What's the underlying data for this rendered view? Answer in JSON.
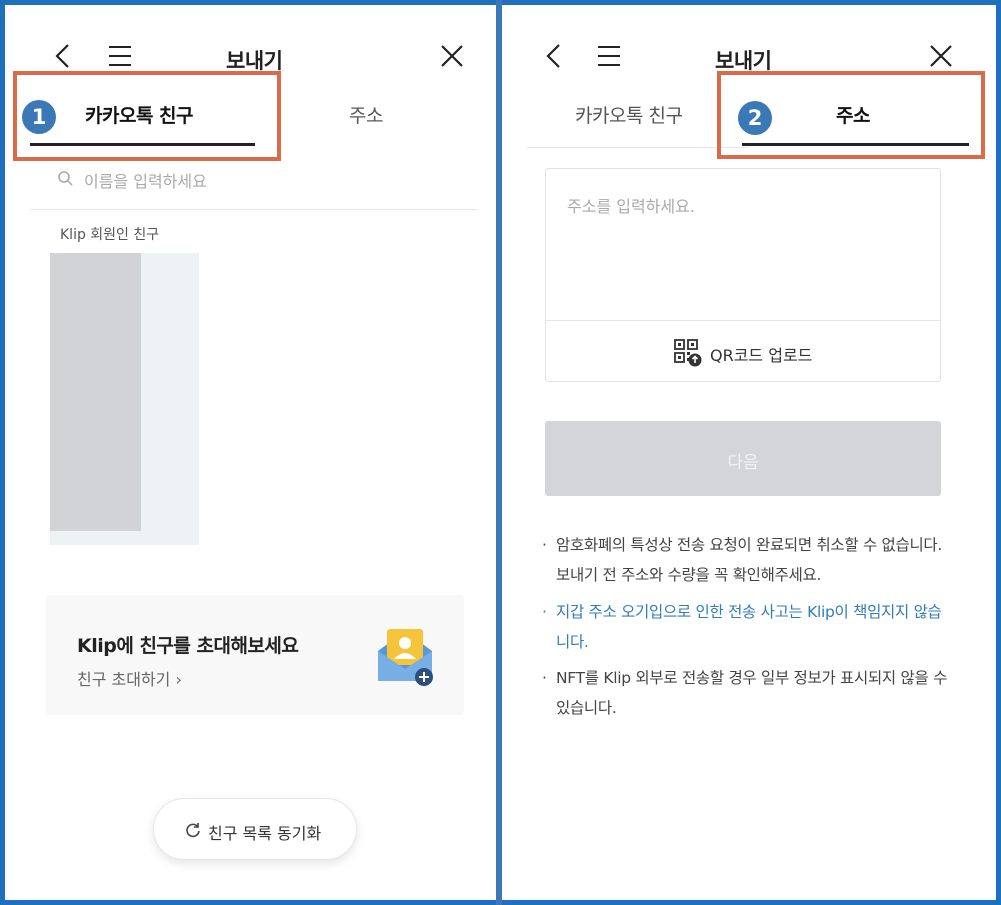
{
  "left": {
    "title": "보내기",
    "tabs": [
      {
        "label": "카카오톡 친구",
        "active": true
      },
      {
        "label": "주소",
        "active": false
      }
    ],
    "badge": "1",
    "search_placeholder": "이름을 입력하세요",
    "section_label": "Klip 회원인 친구",
    "invite": {
      "title": "Klip에 친구를 초대해보세요",
      "link": "친구 초대하기 ›"
    },
    "sync_button": "친구 목록 동기화"
  },
  "right": {
    "title": "보내기",
    "tabs": [
      {
        "label": "카카오톡 친구",
        "active": false
      },
      {
        "label": "주소",
        "active": true
      }
    ],
    "badge": "2",
    "address_placeholder": "주소를 입력하세요.",
    "qr_upload": "QR코드 업로드",
    "next_button": "다음",
    "notes": [
      {
        "bullet": "·",
        "text": "암호화폐의 특성상 전송 요청이 완료되면 취소할 수 없습니다. 보내기 전 주소와 수량을 꼭 확인해주세요.",
        "color": "#444444"
      },
      {
        "bullet": "·",
        "text": "지갑 주소 오기입으로 인한 전송 사고는 Klip이 책임지지 않습니다.",
        "color": "#2f7db8"
      },
      {
        "bullet": "·",
        "text": "NFT를 Klip 외부로 전송할 경우 일부 정보가 표시되지 않을 수 있습니다.",
        "color": "#444444"
      }
    ]
  },
  "colors": {
    "frame": "#1f6fbf",
    "highlight": "#d96a4a",
    "badge": "#3b78b6",
    "warning_text": "#2f7db8",
    "disabled_button": "#d3d5d8"
  },
  "icons": [
    "back-arrow-icon",
    "hamburger-menu-icon",
    "close-icon",
    "search-icon",
    "envelope-user-icon",
    "refresh-icon",
    "qr-code-icon"
  ]
}
